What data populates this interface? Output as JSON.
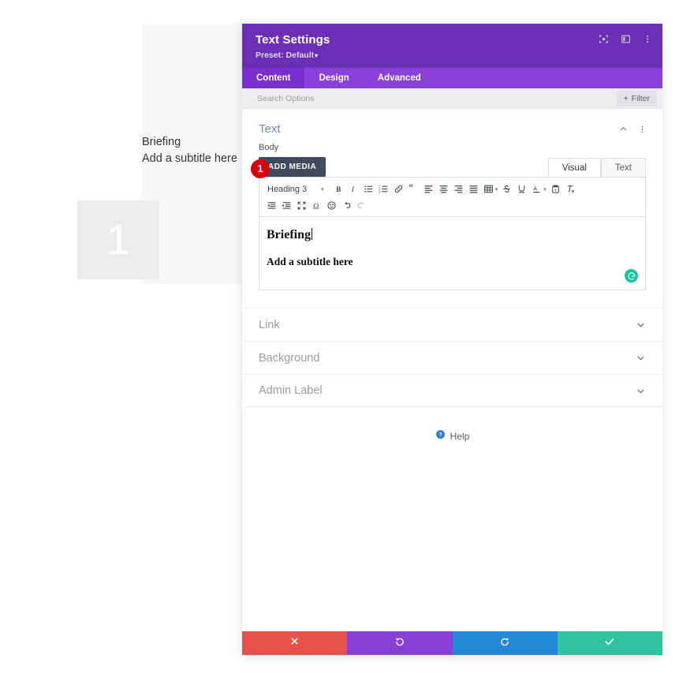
{
  "preview": {
    "heading": "Briefing",
    "subtitle": "Add a subtitle here",
    "number_block": "1"
  },
  "modal": {
    "title": "Text Settings",
    "preset": "Preset: Default",
    "preset_caret": "▾",
    "header_icons": [
      {
        "name": "focus-icon",
        "title": "Focus"
      },
      {
        "name": "panel-layout-icon",
        "title": "Layout"
      },
      {
        "name": "more-vertical-icon",
        "title": "More"
      }
    ],
    "tabs": [
      {
        "label": "Content",
        "active": true
      },
      {
        "label": "Design",
        "active": false
      },
      {
        "label": "Advanced",
        "active": false
      }
    ],
    "search": {
      "placeholder": "Search Options",
      "filter_label": "Filter",
      "filter_plus": "+"
    }
  },
  "section": {
    "title": "Text",
    "collapse_icon": "chevron-up-icon",
    "more_icon": "more-vertical-icon",
    "field_label": "Body"
  },
  "editor": {
    "add_media_label": "ADD MEDIA",
    "mode_tabs": [
      {
        "label": "Visual",
        "active": true
      },
      {
        "label": "Text",
        "active": false
      }
    ],
    "format_select": "Heading 3",
    "toolbar_row1": [
      "bold-icon",
      "italic-icon",
      "bulleted-list-icon",
      "numbered-list-icon",
      "link-icon",
      "blockquote-icon",
      "align-left-icon",
      "align-center-icon",
      "align-right-icon",
      "align-justify-icon",
      "table-icon",
      "strikethrough-icon",
      "underline-icon",
      "text-color-icon",
      "paste-as-text-icon",
      "clear-formatting-icon"
    ],
    "toolbar_row2": [
      "outdent-icon",
      "indent-icon",
      "fullscreen-icon",
      "special-character-icon",
      "emoji-icon",
      "undo-icon",
      "redo-icon"
    ],
    "body_heading": "Briefing",
    "body_paragraph": "Add a subtitle here",
    "grammarly_icon": "grammarly-icon",
    "step_badge": "1"
  },
  "accordion": [
    {
      "label": "Link"
    },
    {
      "label": "Background"
    },
    {
      "label": "Admin Label"
    }
  ],
  "help": {
    "label": "Help",
    "icon": "question-circle-icon"
  },
  "footer_buttons": [
    {
      "name": "discard-button",
      "icon": "close-icon",
      "color": "#e8504a"
    },
    {
      "name": "undo-button",
      "icon": "undo-icon",
      "color": "#8a3fd6"
    },
    {
      "name": "redo-button",
      "icon": "redo-icon",
      "color": "#2389d6"
    },
    {
      "name": "save-button",
      "icon": "check-icon",
      "color": "#2ec2a0"
    }
  ],
  "colors": {
    "header_purple": "#6b2fb5",
    "tabs_purple": "#8b3fdb",
    "active_tab_purple": "#7b2ed0",
    "badge_red": "#d6000e",
    "grammarly_green": "#15c39a",
    "add_media_slate": "#3f4c5e"
  }
}
